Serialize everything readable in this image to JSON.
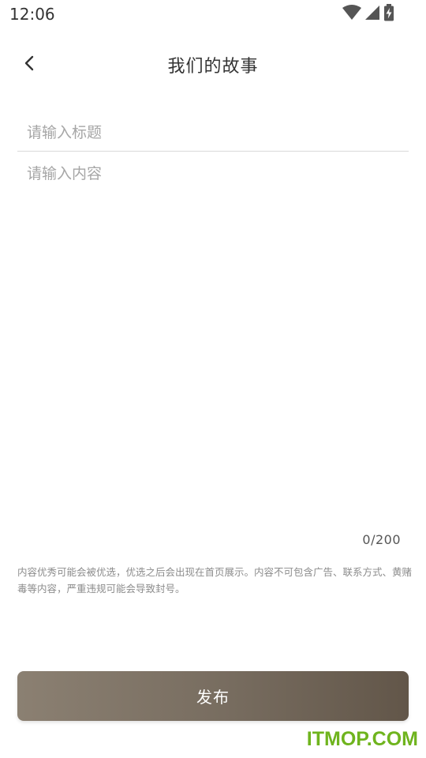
{
  "status_bar": {
    "time": "12:06",
    "icons": [
      "wifi-icon",
      "cellular-signal-icon",
      "battery-charging-icon"
    ]
  },
  "header": {
    "title": "我们的故事",
    "back_icon": "chevron-left-icon"
  },
  "form": {
    "title_placeholder": "请输入标题",
    "title_value": "",
    "content_placeholder": "请输入内容",
    "content_value": "",
    "char_counter": "0/200"
  },
  "notice": "内容优秀可能会被优选，优选之后会出现在首页展示。内容不可包含广告、联系方式、黄赌毒等内容，严重违规可能会导致封号。",
  "publish_button": {
    "label": "发布"
  },
  "watermark": "ITMOP.COM",
  "colors": {
    "button_gradient_start": "#8b8072",
    "button_gradient_end": "#625649",
    "watermark": "#6fb41e",
    "placeholder": "#a6a6a6"
  }
}
